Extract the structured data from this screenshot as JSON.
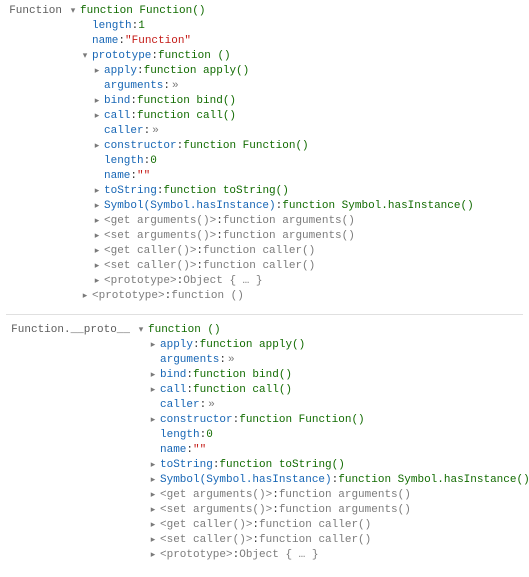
{
  "sections": [
    {
      "label": "Function",
      "root": {
        "twist": "down",
        "value_type": "fn",
        "value": "function Function()"
      },
      "children": [
        {
          "indent": 1,
          "twist": "none",
          "key": "length",
          "key_style": "blue",
          "value_type": "num",
          "value": "1"
        },
        {
          "indent": 1,
          "twist": "none",
          "key": "name",
          "key_style": "blue",
          "value_type": "str",
          "value": "\"Function\""
        },
        {
          "indent": 1,
          "twist": "down",
          "key": "prototype",
          "key_style": "blue",
          "value_type": "fn",
          "value": "function ()"
        },
        {
          "indent": 2,
          "twist": "right",
          "key": "apply",
          "key_style": "blue",
          "value_type": "fn",
          "value": "function apply()"
        },
        {
          "indent": 2,
          "twist": "none",
          "key": "arguments",
          "key_style": "blue",
          "value_type": "raquo",
          "value": "»"
        },
        {
          "indent": 2,
          "twist": "right",
          "key": "bind",
          "key_style": "blue",
          "value_type": "fn",
          "value": "function bind()"
        },
        {
          "indent": 2,
          "twist": "right",
          "key": "call",
          "key_style": "blue",
          "value_type": "fn",
          "value": "function call()"
        },
        {
          "indent": 2,
          "twist": "none",
          "key": "caller",
          "key_style": "blue",
          "value_type": "raquo",
          "value": "»"
        },
        {
          "indent": 2,
          "twist": "right",
          "key": "constructor",
          "key_style": "blue",
          "value_type": "fn",
          "value": "function Function()"
        },
        {
          "indent": 2,
          "twist": "none",
          "key": "length",
          "key_style": "blue",
          "value_type": "num",
          "value": "0"
        },
        {
          "indent": 2,
          "twist": "none",
          "key": "name",
          "key_style": "blue",
          "value_type": "str",
          "value": "\"\""
        },
        {
          "indent": 2,
          "twist": "right",
          "key": "toString",
          "key_style": "blue",
          "value_type": "fn",
          "value": "function toString()"
        },
        {
          "indent": 2,
          "twist": "right",
          "key": "Symbol(Symbol.hasInstance)",
          "key_style": "blue",
          "value_type": "fn",
          "value": "function Symbol.hasInstance()"
        },
        {
          "indent": 2,
          "twist": "right",
          "key": "<get arguments()>",
          "key_style": "gray",
          "value_type": "fn-gray",
          "value": "function arguments()"
        },
        {
          "indent": 2,
          "twist": "right",
          "key": "<set arguments()>",
          "key_style": "gray",
          "value_type": "fn-gray",
          "value": "function arguments()"
        },
        {
          "indent": 2,
          "twist": "right",
          "key": "<get caller()>",
          "key_style": "gray",
          "value_type": "fn-gray",
          "value": "function caller()"
        },
        {
          "indent": 2,
          "twist": "right",
          "key": "<set caller()>",
          "key_style": "gray",
          "value_type": "fn-gray",
          "value": "function caller()"
        },
        {
          "indent": 2,
          "twist": "right",
          "key": "<prototype>",
          "key_style": "gray",
          "value_type": "fn-gray",
          "value": "Object { … }"
        },
        {
          "indent": 1,
          "twist": "right",
          "key": "<prototype>",
          "key_style": "gray",
          "value_type": "fn-gray",
          "value": "function ()"
        }
      ]
    },
    {
      "label": "Function.__proto__",
      "root": {
        "twist": "down",
        "value_type": "fn",
        "value": "function ()"
      },
      "children": [
        {
          "indent": 1,
          "twist": "right",
          "key": "apply",
          "key_style": "blue",
          "value_type": "fn",
          "value": "function apply()"
        },
        {
          "indent": 1,
          "twist": "none",
          "key": "arguments",
          "key_style": "blue",
          "value_type": "raquo",
          "value": "»"
        },
        {
          "indent": 1,
          "twist": "right",
          "key": "bind",
          "key_style": "blue",
          "value_type": "fn",
          "value": "function bind()"
        },
        {
          "indent": 1,
          "twist": "right",
          "key": "call",
          "key_style": "blue",
          "value_type": "fn",
          "value": "function call()"
        },
        {
          "indent": 1,
          "twist": "none",
          "key": "caller",
          "key_style": "blue",
          "value_type": "raquo",
          "value": "»"
        },
        {
          "indent": 1,
          "twist": "right",
          "key": "constructor",
          "key_style": "blue",
          "value_type": "fn",
          "value": "function Function()"
        },
        {
          "indent": 1,
          "twist": "none",
          "key": "length",
          "key_style": "blue",
          "value_type": "num",
          "value": "0"
        },
        {
          "indent": 1,
          "twist": "none",
          "key": "name",
          "key_style": "blue",
          "value_type": "str",
          "value": "\"\""
        },
        {
          "indent": 1,
          "twist": "right",
          "key": "toString",
          "key_style": "blue",
          "value_type": "fn",
          "value": "function toString()"
        },
        {
          "indent": 1,
          "twist": "right",
          "key": "Symbol(Symbol.hasInstance)",
          "key_style": "blue",
          "value_type": "fn",
          "value": "function Symbol.hasInstance()"
        },
        {
          "indent": 1,
          "twist": "right",
          "key": "<get arguments()>",
          "key_style": "gray",
          "value_type": "fn-gray",
          "value": "function arguments()"
        },
        {
          "indent": 1,
          "twist": "right",
          "key": "<set arguments()>",
          "key_style": "gray",
          "value_type": "fn-gray",
          "value": "function arguments()"
        },
        {
          "indent": 1,
          "twist": "right",
          "key": "<get caller()>",
          "key_style": "gray",
          "value_type": "fn-gray",
          "value": "function caller()"
        },
        {
          "indent": 1,
          "twist": "right",
          "key": "<set caller()>",
          "key_style": "gray",
          "value_type": "fn-gray",
          "value": "function caller()"
        },
        {
          "indent": 1,
          "twist": "right",
          "key": "<prototype>",
          "key_style": "gray",
          "value_type": "fn-gray",
          "value": "Object { … }"
        }
      ]
    }
  ],
  "glyphs": {
    "down": "▾",
    "right": "▸"
  }
}
